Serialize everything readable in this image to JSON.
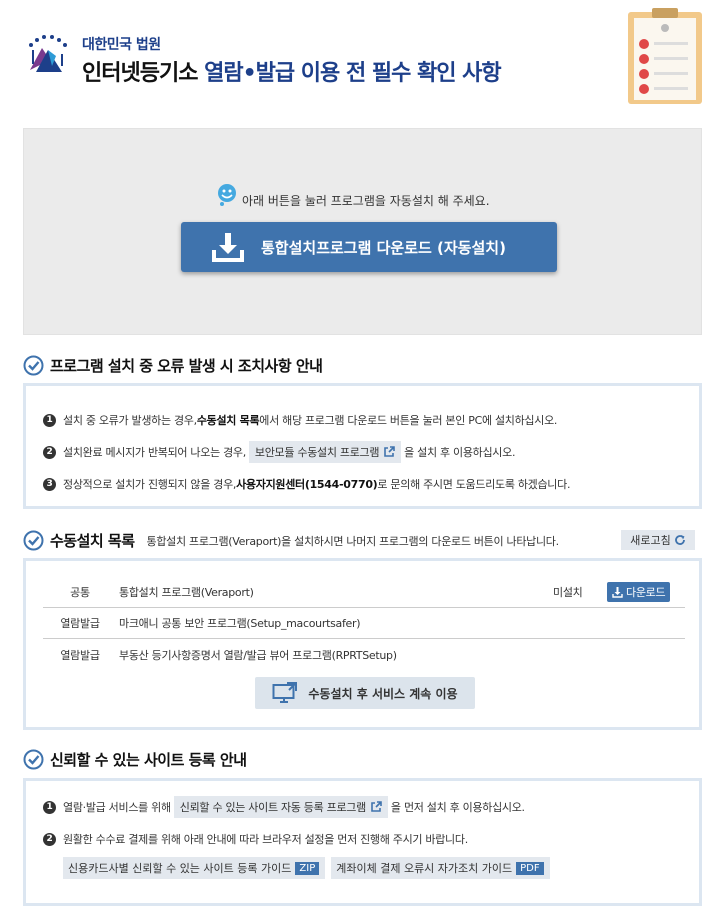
{
  "header": {
    "court_name": "대한민국 법원",
    "title_prefix": "인터넷등기소",
    "title_accent": "열람•발급 이용 전 필수 확인 사항"
  },
  "auto_install": {
    "hint": "아래 버튼을 눌러 프로그램을 자동설치 해 주세요.",
    "button_label": "통합설치프로그램 다운로드 (자동설치)"
  },
  "error_section": {
    "title": "프로그램 설치 중 오류 발생 시 조치사항 안내",
    "items": [
      {
        "num": "1",
        "pre": "설치 중 오류가 발생하는 경우, ",
        "bold": "수동설치 목록",
        "post": "에서 해당 프로그램 다운로드 버튼을 눌러 본인 PC에 설치하십시오."
      },
      {
        "num": "2",
        "pre": "설치완료 메시지가 반복되어 나오는 경우, ",
        "chip": "보안모듈 수동설치 프로그램",
        "post": "을 설치 후 이용하십시오."
      },
      {
        "num": "3",
        "pre": "정상적으로 설치가 진행되지 않을 경우, ",
        "bold": "사용자지원센터(1544-0770)",
        "post": "로 문의해 주시면 도움드리도록 하겠습니다."
      }
    ]
  },
  "manual_section": {
    "title": "수동설치 목록",
    "desc": "통합설치 프로그램(Veraport)을 설치하시면 나머지 프로그램의 다운로드 버튼이 나타납니다.",
    "refresh_label": "새로고침",
    "rows": [
      {
        "category": "공통",
        "name": "통합설치 프로그램(Veraport)",
        "status": "미설치",
        "action": "다운로드"
      },
      {
        "category": "열람발급",
        "name": "마크애니 공통 보안 프로그램(Setup_macourtsafer)",
        "status": "",
        "action": ""
      },
      {
        "category": "열람발급",
        "name": "부동산 등기사항증명서 열람/발급 뷰어 프로그램(RPRTSetup)",
        "status": "",
        "action": ""
      }
    ],
    "continue_label": "수동설치 후 서비스 계속 이용"
  },
  "trust_section": {
    "title": "신뢰할 수 있는 사이트 등록 안내",
    "items": [
      {
        "num": "1",
        "pre": "열람·발급 서비스를 위해 ",
        "chip": "신뢰할 수 있는 사이트 자동 등록 프로그램",
        "post": " 을 먼저 설치 후 이용하십시오."
      },
      {
        "num": "2",
        "text": "원활한 수수료 결제를 위해 아래 안내에 따라 브라우저 설정을 먼저 진행해 주시기 바랍니다."
      }
    ],
    "guides": [
      {
        "label": "신용카드사별 신뢰할 수 있는 사이트 등록 가이드",
        "badge": "ZIP"
      },
      {
        "label": "계좌이체 결제 오류시 자가조치 가이드",
        "badge": "PDF"
      }
    ]
  },
  "colors": {
    "primary": "#3f73ad",
    "panel_border": "#dce6f1",
    "chip_bg": "#e3e8ee",
    "title_accent": "#1d3f8a"
  }
}
